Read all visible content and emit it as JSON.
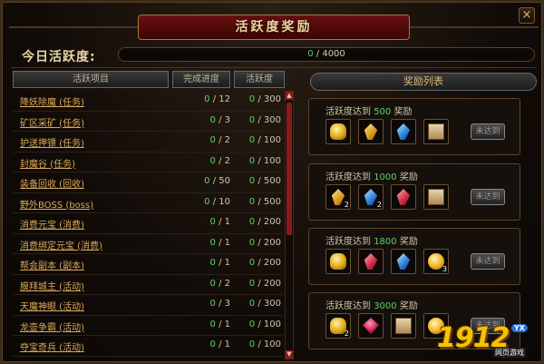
{
  "window": {
    "title": "活跃度奖励",
    "close_glyph": "×"
  },
  "today": {
    "label": "今日活跃度:",
    "current": "0",
    "separator": " / ",
    "max": "4000",
    "progress_fraction": 0
  },
  "table": {
    "headers": [
      "活跃项目",
      "完成进度",
      "活跃度"
    ],
    "rows": [
      {
        "name": "降妖除魔 (任务)",
        "done": "0",
        "total": "12",
        "pts": "0",
        "max": "300"
      },
      {
        "name": "矿区采矿 (任务)",
        "done": "0",
        "total": "3",
        "pts": "0",
        "max": "300"
      },
      {
        "name": "护送押镖 (任务)",
        "done": "0",
        "total": "2",
        "pts": "0",
        "max": "100"
      },
      {
        "name": "封魔谷 (任务)",
        "done": "0",
        "total": "2",
        "pts": "0",
        "max": "100"
      },
      {
        "name": "装备回收 (回收)",
        "done": "0",
        "total": "50",
        "pts": "0",
        "max": "500"
      },
      {
        "name": "野外BOSS (boss)",
        "done": "0",
        "total": "10",
        "pts": "0",
        "max": "500"
      },
      {
        "name": "消费元宝 (消费)",
        "done": "0",
        "total": "1",
        "pts": "0",
        "max": "200"
      },
      {
        "name": "消费绑定元宝 (消费)",
        "done": "0",
        "total": "1",
        "pts": "0",
        "max": "200"
      },
      {
        "name": "帮会副本 (副本)",
        "done": "0",
        "total": "1",
        "pts": "0",
        "max": "200"
      },
      {
        "name": "膜拜城主 (活动)",
        "done": "0",
        "total": "2",
        "pts": "0",
        "max": "200"
      },
      {
        "name": "天魔神眼 (活动)",
        "done": "0",
        "total": "3",
        "pts": "0",
        "max": "300"
      },
      {
        "name": "龙壶争霸 (活动)",
        "done": "0",
        "total": "1",
        "pts": "0",
        "max": "100"
      },
      {
        "name": "夺宝奇兵 (活动)",
        "done": "0",
        "total": "1",
        "pts": "0",
        "max": "100"
      }
    ]
  },
  "rewards": {
    "header": "奖励列表",
    "prefix": "活跃度达到",
    "suffix": "奖励",
    "claim_label": "未达到",
    "tiers": [
      {
        "req": "500",
        "items": [
          {
            "icon": "gold-ingot-icon",
            "cls": "ic-gold",
            "qty": ""
          },
          {
            "icon": "yellow-crystal-icon",
            "cls": "ic-crystal-y",
            "qty": ""
          },
          {
            "icon": "blue-crystal-icon",
            "cls": "ic-crystal-b",
            "qty": ""
          },
          {
            "icon": "scroll-icon",
            "cls": "ic-scroll",
            "qty": ""
          }
        ]
      },
      {
        "req": "1000",
        "items": [
          {
            "icon": "yellow-crystal-icon",
            "cls": "ic-crystal-y",
            "qty": "2"
          },
          {
            "icon": "blue-crystal-icon",
            "cls": "ic-crystal-b",
            "qty": "2"
          },
          {
            "icon": "red-crystal-icon",
            "cls": "ic-crystal-r",
            "qty": ""
          },
          {
            "icon": "scroll-icon",
            "cls": "ic-scroll",
            "qty": ""
          }
        ]
      },
      {
        "req": "1800",
        "items": [
          {
            "icon": "gold-ingot-icon",
            "cls": "ic-gold",
            "qty": ""
          },
          {
            "icon": "red-crystal-icon",
            "cls": "ic-crystal-r",
            "qty": ""
          },
          {
            "icon": "blue-crystal-icon",
            "cls": "ic-crystal-b",
            "qty": ""
          },
          {
            "icon": "gold-orb-icon",
            "cls": "ic-orb",
            "qty": "3"
          }
        ]
      },
      {
        "req": "3000",
        "items": [
          {
            "icon": "gold-ingot-icon",
            "cls": "ic-gold",
            "qty": "2"
          },
          {
            "icon": "red-gem-icon",
            "cls": "ic-gem-r",
            "qty": ""
          },
          {
            "icon": "scroll-icon",
            "cls": "ic-scroll",
            "qty": ""
          },
          {
            "icon": "gold-orb-icon",
            "cls": "ic-orb",
            "qty": ""
          }
        ]
      }
    ]
  },
  "watermark": {
    "number": "1912",
    "badge": "YX",
    "sub": "网页游戏"
  },
  "colors": {
    "accent_green": "#5fd25f",
    "link_gold": "#d9a85a",
    "title_red": "#6a0f0f"
  }
}
